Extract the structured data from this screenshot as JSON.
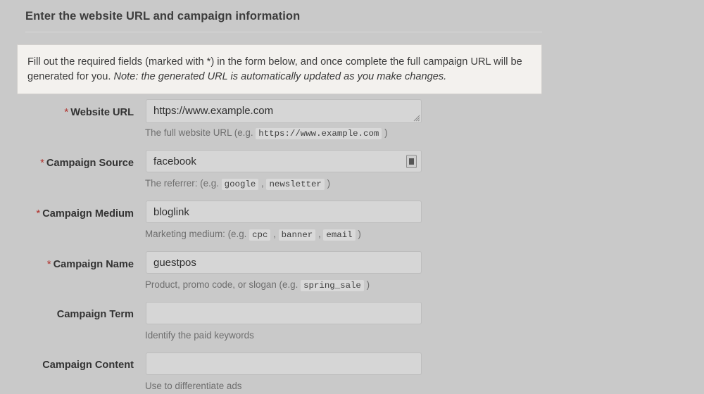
{
  "header": {
    "title": "Enter the website URL and campaign information"
  },
  "info_box": {
    "text_main": "Fill out the required fields (marked with *) in the form below, and once complete the full campaign URL will be generated for you. ",
    "text_note": "Note: the generated URL is automatically updated as you make changes."
  },
  "form": {
    "required_marker": "*",
    "fields": [
      {
        "label": "Website URL",
        "required": true,
        "value": "https://www.example.com",
        "placeholder": "",
        "help_prefix": "The full website URL (e.g.",
        "help_examples": [
          "https://www.example.com"
        ],
        "help_suffix": ")",
        "control": "textarea",
        "icon": ""
      },
      {
        "label": "Campaign Source",
        "required": true,
        "value": "facebook",
        "placeholder": "",
        "help_prefix": "The referrer: (e.g.",
        "help_examples": [
          "google",
          "newsletter"
        ],
        "help_suffix": ")",
        "control": "input",
        "icon": "autofill-icon"
      },
      {
        "label": "Campaign Medium",
        "required": true,
        "value": "bloglink",
        "placeholder": "",
        "help_prefix": "Marketing medium: (e.g.",
        "help_examples": [
          "cpc",
          "banner",
          "email"
        ],
        "help_suffix": ")",
        "control": "input",
        "icon": ""
      },
      {
        "label": "Campaign Name",
        "required": true,
        "value": "guestpos",
        "placeholder": "",
        "help_prefix": "Product, promo code, or slogan (e.g.",
        "help_examples": [
          "spring_sale"
        ],
        "help_suffix": ")",
        "control": "input",
        "icon": ""
      },
      {
        "label": "Campaign Term",
        "required": false,
        "value": "",
        "placeholder": "",
        "help_prefix": "Identify the paid keywords",
        "help_examples": [],
        "help_suffix": "",
        "control": "input",
        "icon": ""
      },
      {
        "label": "Campaign Content",
        "required": false,
        "value": "",
        "placeholder": "",
        "help_prefix": "Use to differentiate ads",
        "help_examples": [],
        "help_suffix": "",
        "control": "input",
        "icon": ""
      }
    ]
  },
  "colors": {
    "page_background": "#c9c9c9",
    "info_box_background": "#f3f1ee",
    "input_background": "#d6d6d6",
    "required_star": "#b1332e",
    "help_text": "#6e6e6e"
  }
}
